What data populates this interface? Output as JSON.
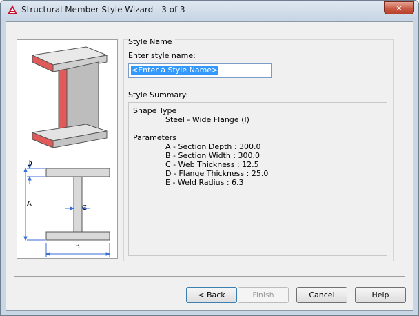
{
  "window": {
    "title": "Structural Member Style Wizard - 3 of 3",
    "close_symbol": "✕"
  },
  "style_name": {
    "group_label": "Style Name",
    "prompt_label": "Enter style name:",
    "input_value": "<Enter a Style Name>"
  },
  "summary": {
    "label": "Style Summary:",
    "shape_type_heading": "Shape Type",
    "shape_type_value": "Steel - Wide Flange (I)",
    "parameters_heading": "Parameters",
    "parameters": [
      "A - Section Depth : 300.0",
      "B - Section Width : 300.0",
      "C - Web Thickness : 12.5",
      "D - Flange Thickness : 25.0",
      "E - Weld Radius : 6.3"
    ]
  },
  "diagram": {
    "labels": [
      "D",
      "A",
      "C",
      "B"
    ],
    "accent_color": "#e05a5a",
    "dimension_color": "#3a6ed8"
  },
  "buttons": {
    "back": "< Back",
    "finish": "Finish",
    "cancel": "Cancel",
    "help": "Help"
  }
}
